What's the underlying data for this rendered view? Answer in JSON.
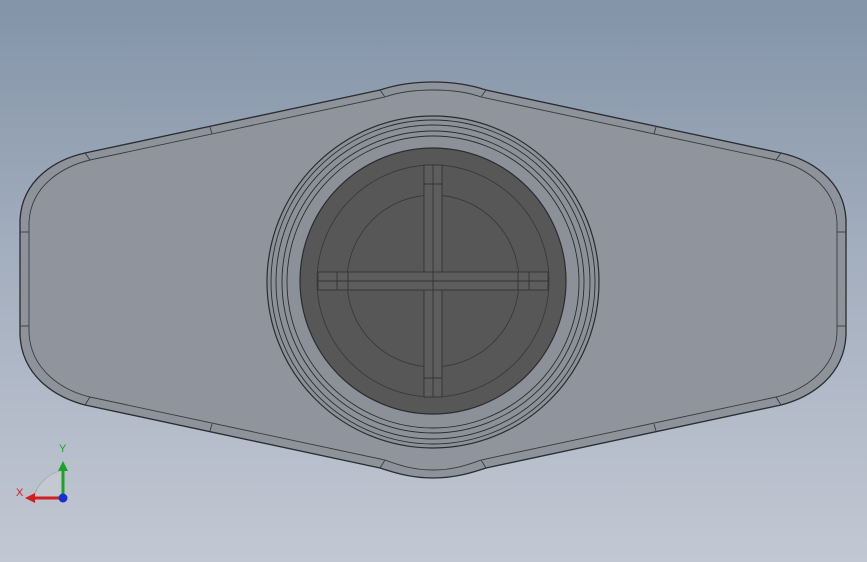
{
  "viewport": {
    "model": "wing-nut-cap",
    "view": "top"
  },
  "triad": {
    "x_label": "X",
    "y_label": "Y",
    "x_color": "#d02020",
    "y_color": "#1fa02a",
    "z_color": "#1a2fd0"
  },
  "colors": {
    "body_fill": "#8e939b",
    "body_edge": "#2a2c30",
    "cavity_fill": "#575757",
    "rib_fill": "#5d5d5d"
  }
}
